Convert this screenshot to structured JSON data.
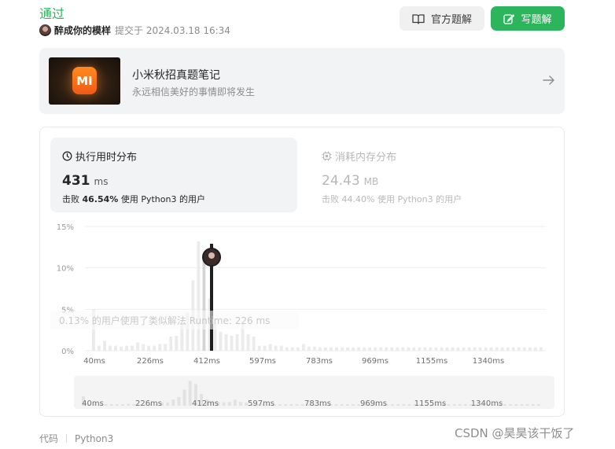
{
  "status": "通过",
  "author": {
    "name": "醉成你的模样",
    "submitted": "提交于 2024.03.18 16:34"
  },
  "buttons": {
    "official_solution": "官方题解",
    "write_solution": "写题解"
  },
  "banner": {
    "title": "小米秋招真题笔记",
    "subtitle": "永远相信美好的事情即将发生",
    "logo_text": "MI"
  },
  "runtime": {
    "heading": "执行用时分布",
    "value": "431",
    "unit": "ms",
    "beat_prefix": "击败",
    "beat_percent": "46.54%",
    "beat_suffix": "使用 Python3 的用户"
  },
  "memory": {
    "heading": "消耗内存分布",
    "value": "24.43",
    "unit": "MB",
    "beat_prefix": "击败",
    "beat_percent": "44.40%",
    "beat_suffix": "使用 Python3 的用户"
  },
  "tooltip": "0.13% 的用户使用了类似解法 Runtime: 226 ms",
  "chart_data": {
    "type": "bar",
    "title": "",
    "xlabel": "",
    "ylabel": "",
    "y_ticks": [
      "15%",
      "10%",
      "5%",
      "0%"
    ],
    "ylim": [
      0,
      15
    ],
    "x_ticks": [
      "40ms",
      "226ms",
      "412ms",
      "597ms",
      "783ms",
      "969ms",
      "1155ms",
      "1340ms"
    ],
    "values": [
      5.0,
      0.6,
      1.2,
      0.6,
      0.6,
      0.5,
      0.6,
      0.6,
      1.0,
      0.8,
      0.6,
      0.6,
      0.8,
      0.8,
      1.7,
      1.8,
      3.3,
      4.6,
      8.5,
      13.2,
      11.5,
      6.3,
      3.4,
      2.3,
      2.0,
      1.8,
      2.0,
      3.2,
      2.0,
      1.7,
      0.6,
      0.6,
      0.8,
      0.6,
      0.6,
      0.4,
      0.4,
      0.4,
      0.8,
      0.5,
      0.5,
      0.4,
      0.4,
      0.4,
      0.4,
      0.4,
      0.4,
      0.4,
      0.4,
      0.4,
      0.4,
      0.4,
      0.4,
      0.4,
      0.4,
      0.4,
      0.4,
      0.4,
      0.4,
      0.4,
      0.4,
      0.4,
      0.4,
      0.4,
      0.4,
      0.4,
      0.4,
      0.4,
      0.4,
      0.4,
      0.4,
      0.4,
      0.4,
      0.4,
      0.4,
      0.4,
      0.4,
      0.4,
      0.4,
      0.4,
      0.4,
      0.4
    ],
    "highlight_index": 20,
    "highlight_label": "431 ms",
    "colors": {
      "bar": "#ebebeb",
      "highlight": "#1f1f1f",
      "grid": "#eeeeee"
    }
  },
  "footer": {
    "code_label": "代码",
    "language": "Python3"
  },
  "watermark": "CSDN @昊昊该干饭了"
}
